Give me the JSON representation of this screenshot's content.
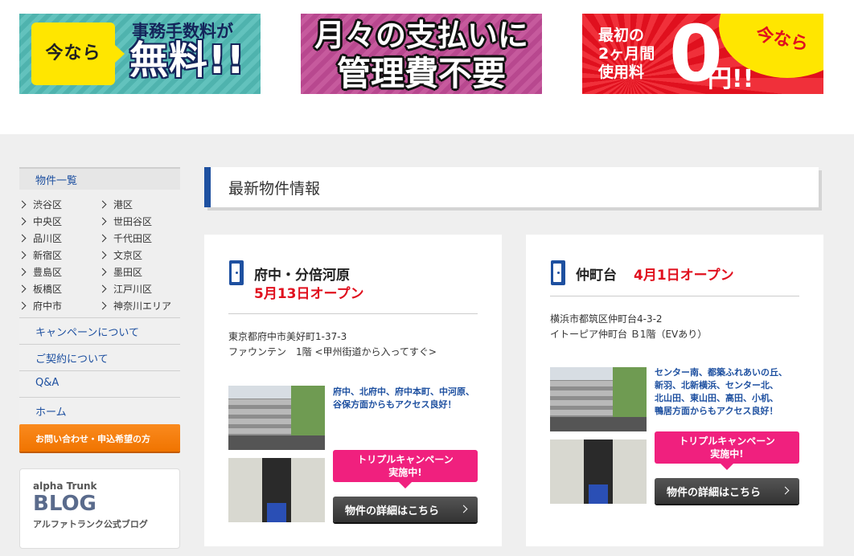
{
  "banners": [
    {
      "badge": "今なら",
      "line1": "事務手数料が",
      "line2": "無料!!"
    },
    {
      "line1": "月々の支払いに",
      "line2": "管理費不要"
    },
    {
      "badge": "今なら",
      "line1": "最初の",
      "line2": "2ヶ月間",
      "line3": "使用料",
      "big": "0",
      "unit": "円!!"
    }
  ],
  "sidebar": {
    "heading": "物件一覧",
    "areas": [
      "渋谷区",
      "港区",
      "中央区",
      "世田谷区",
      "品川区",
      "千代田区",
      "新宿区",
      "文京区",
      "豊島区",
      "墨田区",
      "板橋区",
      "江戸川区",
      "府中市",
      "神奈川エリア"
    ],
    "links": [
      "キャンペーンについて",
      "ご契約について",
      "Q&A",
      "ホーム"
    ],
    "cta": "お問い合わせ・申込希望の方",
    "blog": {
      "small": "alpha Trunk",
      "big": "BLOG",
      "sub": "アルファトランク公式ブログ"
    }
  },
  "main": {
    "section_title": "最新物件情報",
    "cards": [
      {
        "name": "府中・分倍河原",
        "open": "5月13日オープン",
        "address_line1": "東京都府中市美好町1-37-3",
        "address_line2": "ファウンテン　1階 <甲州街道から入ってすぐ>",
        "access": [
          "府中、北府中、府中本町、中河原、",
          "谷保方面からもアクセス良好！"
        ],
        "campaign": [
          "トリプルキャンペーン",
          "実施中!"
        ],
        "detail": "物件の詳細はこちら"
      },
      {
        "name": "仲町台",
        "open": "4月1日オープン",
        "address_line1": "横浜市都筑区仲町台4-3-2",
        "address_line2": "イトーピア仲町台 Ｂ1階（EVあり）",
        "access": [
          "センター南、都築ふれあいの丘、",
          "新羽、北新横浜、センター北、",
          "北山田、東山田、高田、小机、",
          "鴨居方面からもアクセス良好！"
        ],
        "campaign": [
          "トリプルキャンペーン",
          "実施中!"
        ],
        "detail": "物件の詳細はこちら"
      }
    ]
  },
  "colors": {
    "brand_blue": "#1e50a0",
    "cta_orange": "#f07400",
    "campaign_pink": "#f0207e",
    "open_red": "#e0101e"
  }
}
